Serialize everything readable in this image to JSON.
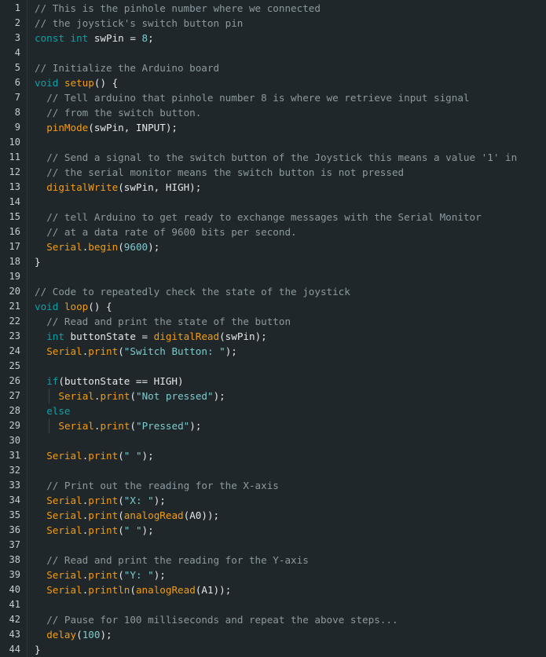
{
  "editor": {
    "colors": {
      "background": "#1f272a",
      "comment": "#8c9aa0",
      "keyword": "#0ca1a6",
      "function": "#f39c12",
      "plain": "#e4e7e8",
      "string": "#7fcbcd"
    },
    "lines": [
      {
        "n": "1",
        "indent": 0,
        "tokens": [
          {
            "t": "comment",
            "v": "// This is the pinhole number where we connected"
          }
        ]
      },
      {
        "n": "2",
        "indent": 0,
        "tokens": [
          {
            "t": "comment",
            "v": "// the joystick's switch button pin"
          }
        ]
      },
      {
        "n": "3",
        "indent": 0,
        "tokens": [
          {
            "t": "keyword",
            "v": "const"
          },
          {
            "t": "plain",
            "v": " "
          },
          {
            "t": "keyword",
            "v": "int"
          },
          {
            "t": "plain",
            "v": " swPin = "
          },
          {
            "t": "number",
            "v": "8"
          },
          {
            "t": "plain",
            "v": ";"
          }
        ]
      },
      {
        "n": "4",
        "indent": 0,
        "tokens": []
      },
      {
        "n": "5",
        "indent": 0,
        "tokens": [
          {
            "t": "comment",
            "v": "// Initialize the Arduino board"
          }
        ]
      },
      {
        "n": "6",
        "indent": 0,
        "tokens": [
          {
            "t": "keyword",
            "v": "void"
          },
          {
            "t": "plain",
            "v": " "
          },
          {
            "t": "func",
            "v": "setup"
          },
          {
            "t": "plain",
            "v": "() {"
          }
        ]
      },
      {
        "n": "7",
        "indent": 1,
        "tokens": [
          {
            "t": "comment",
            "v": "// Tell arduino that pinhole number 8 is where we retrieve input signal"
          }
        ]
      },
      {
        "n": "8",
        "indent": 1,
        "tokens": [
          {
            "t": "comment",
            "v": "// from the switch button."
          }
        ]
      },
      {
        "n": "9",
        "indent": 1,
        "tokens": [
          {
            "t": "func",
            "v": "pinMode"
          },
          {
            "t": "plain",
            "v": "(swPin, INPUT);"
          }
        ]
      },
      {
        "n": "10",
        "indent": 0,
        "tokens": []
      },
      {
        "n": "11",
        "indent": 1,
        "tokens": [
          {
            "t": "comment",
            "v": "// Send a signal to the switch button of the Joystick this means a value '1' in"
          }
        ]
      },
      {
        "n": "12",
        "indent": 1,
        "tokens": [
          {
            "t": "comment",
            "v": "// the serial monitor means the switch button is not pressed"
          }
        ]
      },
      {
        "n": "13",
        "indent": 1,
        "tokens": [
          {
            "t": "func",
            "v": "digitalWrite"
          },
          {
            "t": "plain",
            "v": "(swPin, HIGH);"
          }
        ]
      },
      {
        "n": "14",
        "indent": 0,
        "tokens": []
      },
      {
        "n": "15",
        "indent": 1,
        "tokens": [
          {
            "t": "comment",
            "v": "// tell Arduino to get ready to exchange messages with the Serial Monitor"
          }
        ]
      },
      {
        "n": "16",
        "indent": 1,
        "tokens": [
          {
            "t": "comment",
            "v": "// at a data rate of 9600 bits per second."
          }
        ]
      },
      {
        "n": "17",
        "indent": 1,
        "tokens": [
          {
            "t": "func",
            "v": "Serial"
          },
          {
            "t": "plain",
            "v": "."
          },
          {
            "t": "func",
            "v": "begin"
          },
          {
            "t": "plain",
            "v": "("
          },
          {
            "t": "number",
            "v": "9600"
          },
          {
            "t": "plain",
            "v": ");"
          }
        ]
      },
      {
        "n": "18",
        "indent": 0,
        "tokens": [
          {
            "t": "plain",
            "v": "}"
          }
        ]
      },
      {
        "n": "19",
        "indent": 0,
        "tokens": []
      },
      {
        "n": "20",
        "indent": 0,
        "tokens": [
          {
            "t": "comment",
            "v": "// Code to repeatedly check the state of the joystick"
          }
        ]
      },
      {
        "n": "21",
        "indent": 0,
        "tokens": [
          {
            "t": "keyword",
            "v": "void"
          },
          {
            "t": "plain",
            "v": " "
          },
          {
            "t": "func",
            "v": "loop"
          },
          {
            "t": "plain",
            "v": "() {"
          }
        ]
      },
      {
        "n": "22",
        "indent": 1,
        "tokens": [
          {
            "t": "comment",
            "v": "// Read and print the state of the button"
          }
        ]
      },
      {
        "n": "23",
        "indent": 1,
        "tokens": [
          {
            "t": "keyword",
            "v": "int"
          },
          {
            "t": "plain",
            "v": " buttonState = "
          },
          {
            "t": "func",
            "v": "digitalRead"
          },
          {
            "t": "plain",
            "v": "(swPin);"
          }
        ]
      },
      {
        "n": "24",
        "indent": 1,
        "tokens": [
          {
            "t": "func",
            "v": "Serial"
          },
          {
            "t": "plain",
            "v": "."
          },
          {
            "t": "func",
            "v": "print"
          },
          {
            "t": "plain",
            "v": "("
          },
          {
            "t": "string",
            "v": "\"Switch Button: \""
          },
          {
            "t": "plain",
            "v": ");"
          }
        ]
      },
      {
        "n": "25",
        "indent": 0,
        "tokens": []
      },
      {
        "n": "26",
        "indent": 1,
        "tokens": [
          {
            "t": "keyword",
            "v": "if"
          },
          {
            "t": "plain",
            "v": "(buttonState == HIGH)"
          }
        ]
      },
      {
        "n": "27",
        "indent": 2,
        "tokens": [
          {
            "t": "func",
            "v": "Serial"
          },
          {
            "t": "plain",
            "v": "."
          },
          {
            "t": "func",
            "v": "print"
          },
          {
            "t": "plain",
            "v": "("
          },
          {
            "t": "string",
            "v": "\"Not pressed\""
          },
          {
            "t": "plain",
            "v": ");"
          }
        ]
      },
      {
        "n": "28",
        "indent": 1,
        "tokens": [
          {
            "t": "keyword",
            "v": "else"
          }
        ]
      },
      {
        "n": "29",
        "indent": 2,
        "tokens": [
          {
            "t": "func",
            "v": "Serial"
          },
          {
            "t": "plain",
            "v": "."
          },
          {
            "t": "func",
            "v": "print"
          },
          {
            "t": "plain",
            "v": "("
          },
          {
            "t": "string",
            "v": "\"Pressed\""
          },
          {
            "t": "plain",
            "v": ");"
          }
        ]
      },
      {
        "n": "30",
        "indent": 0,
        "tokens": []
      },
      {
        "n": "31",
        "indent": 1,
        "tokens": [
          {
            "t": "func",
            "v": "Serial"
          },
          {
            "t": "plain",
            "v": "."
          },
          {
            "t": "func",
            "v": "print"
          },
          {
            "t": "plain",
            "v": "("
          },
          {
            "t": "string",
            "v": "\" \""
          },
          {
            "t": "plain",
            "v": ");"
          }
        ]
      },
      {
        "n": "32",
        "indent": 0,
        "tokens": []
      },
      {
        "n": "33",
        "indent": 1,
        "tokens": [
          {
            "t": "comment",
            "v": "// Print out the reading for the X-axis"
          }
        ]
      },
      {
        "n": "34",
        "indent": 1,
        "tokens": [
          {
            "t": "func",
            "v": "Serial"
          },
          {
            "t": "plain",
            "v": "."
          },
          {
            "t": "func",
            "v": "print"
          },
          {
            "t": "plain",
            "v": "("
          },
          {
            "t": "string",
            "v": "\"X: \""
          },
          {
            "t": "plain",
            "v": ");"
          }
        ]
      },
      {
        "n": "35",
        "indent": 1,
        "tokens": [
          {
            "t": "func",
            "v": "Serial"
          },
          {
            "t": "plain",
            "v": "."
          },
          {
            "t": "func",
            "v": "print"
          },
          {
            "t": "plain",
            "v": "("
          },
          {
            "t": "func",
            "v": "analogRead"
          },
          {
            "t": "plain",
            "v": "(A0));"
          }
        ]
      },
      {
        "n": "36",
        "indent": 1,
        "tokens": [
          {
            "t": "func",
            "v": "Serial"
          },
          {
            "t": "plain",
            "v": "."
          },
          {
            "t": "func",
            "v": "print"
          },
          {
            "t": "plain",
            "v": "("
          },
          {
            "t": "string",
            "v": "\" \""
          },
          {
            "t": "plain",
            "v": ");"
          }
        ]
      },
      {
        "n": "37",
        "indent": 0,
        "tokens": []
      },
      {
        "n": "38",
        "indent": 1,
        "tokens": [
          {
            "t": "comment",
            "v": "// Read and print the reading for the Y-axis"
          }
        ]
      },
      {
        "n": "39",
        "indent": 1,
        "tokens": [
          {
            "t": "func",
            "v": "Serial"
          },
          {
            "t": "plain",
            "v": "."
          },
          {
            "t": "func",
            "v": "print"
          },
          {
            "t": "plain",
            "v": "("
          },
          {
            "t": "string",
            "v": "\"Y: \""
          },
          {
            "t": "plain",
            "v": ");"
          }
        ]
      },
      {
        "n": "40",
        "indent": 1,
        "tokens": [
          {
            "t": "func",
            "v": "Serial"
          },
          {
            "t": "plain",
            "v": "."
          },
          {
            "t": "func",
            "v": "println"
          },
          {
            "t": "plain",
            "v": "("
          },
          {
            "t": "func",
            "v": "analogRead"
          },
          {
            "t": "plain",
            "v": "(A1));"
          }
        ]
      },
      {
        "n": "41",
        "indent": 0,
        "tokens": []
      },
      {
        "n": "42",
        "indent": 1,
        "tokens": [
          {
            "t": "comment",
            "v": "// Pause for 100 milliseconds and repeat the above steps..."
          }
        ]
      },
      {
        "n": "43",
        "indent": 1,
        "tokens": [
          {
            "t": "func",
            "v": "delay"
          },
          {
            "t": "plain",
            "v": "("
          },
          {
            "t": "number",
            "v": "100"
          },
          {
            "t": "plain",
            "v": ");"
          }
        ]
      },
      {
        "n": "44",
        "indent": 0,
        "tokens": [
          {
            "t": "plain",
            "v": "}"
          }
        ]
      }
    ]
  }
}
